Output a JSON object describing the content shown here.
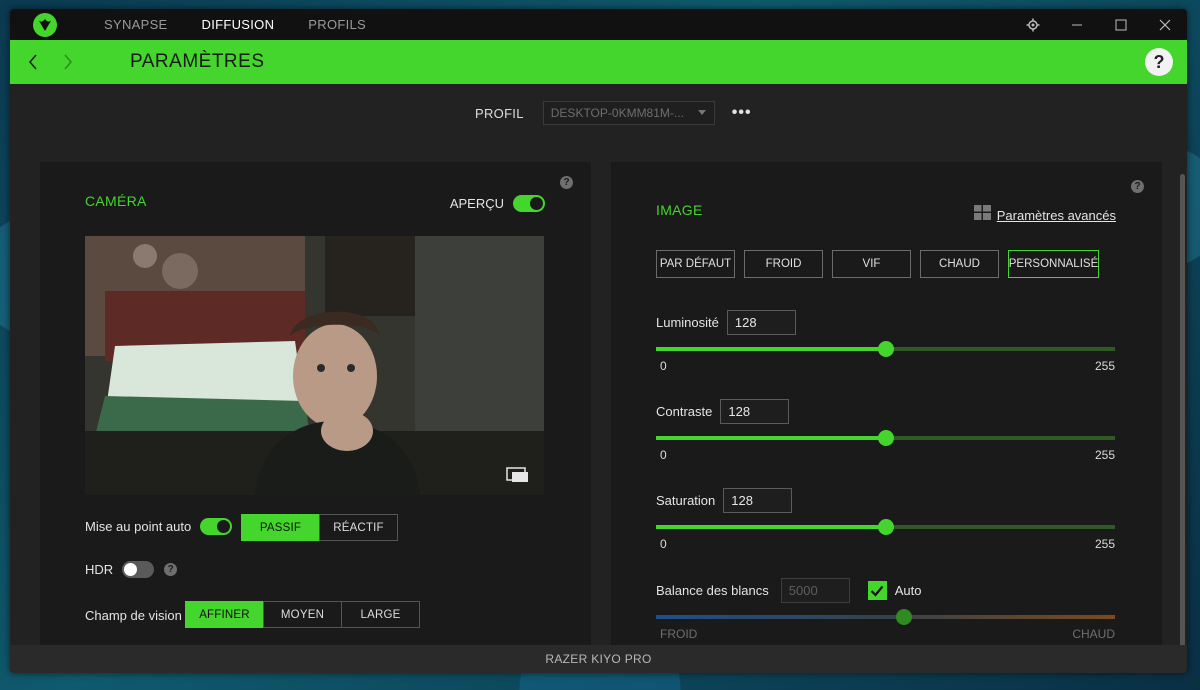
{
  "titlebar": {
    "tabs": [
      {
        "label": "SYNAPSE",
        "active": false
      },
      {
        "label": "DIFFUSION",
        "active": true
      },
      {
        "label": "PROFILS",
        "active": false
      }
    ]
  },
  "header": {
    "title": "PARAMÈTRES",
    "help": "?"
  },
  "profile": {
    "label": "PROFIL",
    "value": "DESKTOP-0KMM81M-...",
    "more": "•••"
  },
  "camera": {
    "title": "CAMÉRA",
    "preview_label": "APERÇU",
    "preview_on": true,
    "autofocus_label": "Mise au point auto",
    "autofocus_on": true,
    "focus_modes": [
      "PASSIF",
      "RÉACTIF"
    ],
    "focus_selected": "PASSIF",
    "hdr_label": "HDR",
    "hdr_on": false,
    "fov_label": "Champ de vision",
    "fov_options": [
      "AFFINER",
      "MOYEN",
      "LARGE"
    ],
    "fov_selected": "AFFINER"
  },
  "image": {
    "title": "IMAGE",
    "advanced_link": "Paramètres avancés",
    "presets": [
      "PAR DÉFAUT",
      "FROID",
      "VIF",
      "CHAUD",
      "PERSONNALISÉ"
    ],
    "preset_selected": "PERSONNALISÉ",
    "brightness": {
      "label": "Luminosité",
      "value": "128",
      "min": "0",
      "max": "255"
    },
    "contrast": {
      "label": "Contraste",
      "value": "128",
      "min": "0",
      "max": "255"
    },
    "saturation": {
      "label": "Saturation",
      "value": "128",
      "min": "0",
      "max": "255"
    },
    "white_balance": {
      "label": "Balance des blancs",
      "value": "5000",
      "auto_label": "Auto",
      "auto_checked": true,
      "min_label": "FROID",
      "max_label": "CHAUD",
      "level": 0.54
    }
  },
  "status": {
    "device": "RAZER KIYO PRO"
  },
  "colors": {
    "accent": "#44d62c",
    "panel": "#1a1a1a",
    "background": "#222222"
  }
}
